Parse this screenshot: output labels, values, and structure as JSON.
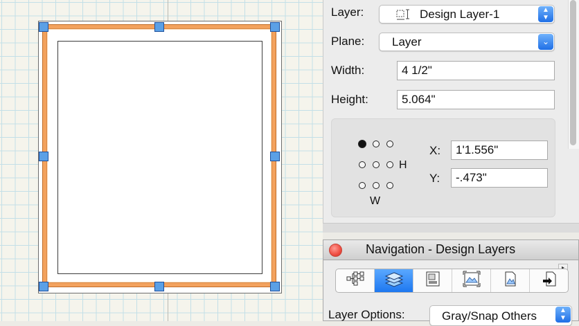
{
  "object_info": {
    "layer": {
      "label": "Layer:",
      "value": "Design Layer-1",
      "icon": "layer-icon"
    },
    "plane": {
      "label": "Plane:",
      "value": "Layer"
    },
    "width": {
      "label": "Width:",
      "value": "4 1/2\""
    },
    "height": {
      "label": "Height:",
      "value": "5.064\""
    },
    "position": {
      "x_label": "X:",
      "x_value": "1'1.556\"",
      "y_label": "Y:",
      "y_value": "-.473\"",
      "h_label": "H",
      "w_label": "W",
      "selected_point": "top-left"
    }
  },
  "navigation": {
    "title": "Navigation - Design Layers",
    "tabs": [
      {
        "name": "classes-tab",
        "icon": "class-hierarchy-icon",
        "active": false
      },
      {
        "name": "design-layers-tab",
        "icon": "stacked-layers-icon",
        "active": true
      },
      {
        "name": "sheet-layers-tab",
        "icon": "sheet-layer-icon",
        "active": false
      },
      {
        "name": "viewports-tab",
        "icon": "viewport-icon",
        "active": false
      },
      {
        "name": "saved-views-tab",
        "icon": "saved-view-icon",
        "active": false
      },
      {
        "name": "references-tab",
        "icon": "reference-icon",
        "active": false
      }
    ],
    "layer_options": {
      "label": "Layer Options:",
      "value": "Gray/Snap Others"
    }
  },
  "colors": {
    "frame": "#f3a25d",
    "handle": "#5ba0e6",
    "accent": "#1e78f0",
    "grid": "#c3dfe7"
  }
}
